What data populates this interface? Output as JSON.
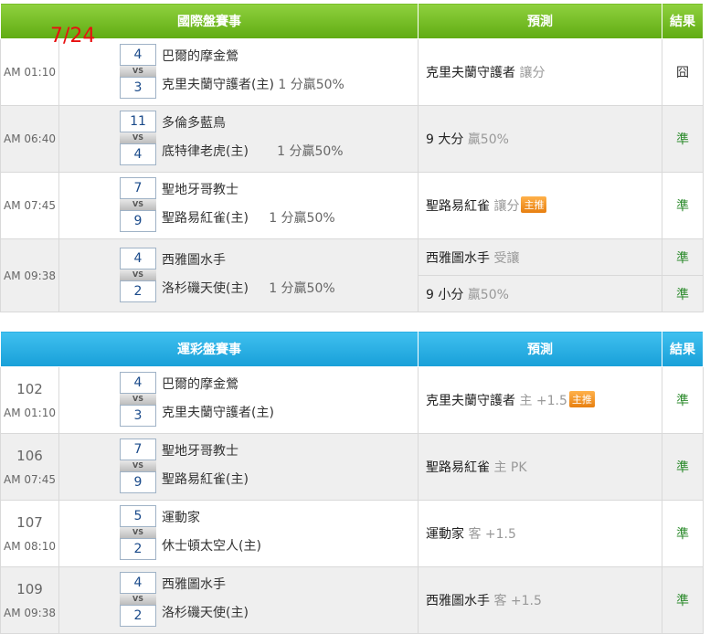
{
  "date_label": "7/24",
  "intl": {
    "header": {
      "title": "國際盤賽事",
      "pred": "預測",
      "res": "結果"
    },
    "rows": [
      {
        "time": "AM 01:10",
        "s1": "4",
        "s2": "3",
        "vs": "VS",
        "team1": "巴爾的摩金鶯",
        "team2": "克里夫蘭守護者(主)",
        "extra": "1 分贏50%",
        "preds": [
          {
            "main": "克里夫蘭守護者",
            "sub": "讓分",
            "res": "囧"
          }
        ]
      },
      {
        "time": "AM 06:40",
        "s1": "11",
        "s2": "4",
        "vs": "VS",
        "team1": "多倫多藍鳥",
        "team2": "底特律老虎(主)",
        "extra": "1 分贏50%",
        "preds": [
          {
            "main": "9 大分",
            "sub": "贏50%",
            "res": "準"
          }
        ]
      },
      {
        "time": "AM 07:45",
        "s1": "7",
        "s2": "9",
        "vs": "VS",
        "team1": "聖地牙哥教士",
        "team2": "聖路易紅雀(主)",
        "extra": "1 分贏50%",
        "preds": [
          {
            "main": "聖路易紅雀",
            "sub": "讓分",
            "badge": "主推",
            "res": "準"
          }
        ]
      },
      {
        "time": "AM 09:38",
        "s1": "4",
        "s2": "2",
        "vs": "VS",
        "team1": "西雅圖水手",
        "team2": "洛杉磯天使(主)",
        "extra": "1 分贏50%",
        "preds": [
          {
            "main": "西雅圖水手",
            "sub": "受讓",
            "res": "準"
          },
          {
            "main": "9 小分",
            "sub": "贏50%",
            "res": "準"
          }
        ]
      }
    ]
  },
  "lottery": {
    "header": {
      "title": "運彩盤賽事",
      "pred": "預測",
      "res": "結果"
    },
    "rows": [
      {
        "num": "102",
        "time": "AM 01:10",
        "s1": "4",
        "s2": "3",
        "vs": "VS",
        "team1": "巴爾的摩金鶯",
        "team2": "克里夫蘭守護者(主)",
        "pred": "克里夫蘭守護者",
        "sub": "主 +1.5",
        "badge": "主推",
        "res": "準"
      },
      {
        "num": "106",
        "time": "AM 07:45",
        "s1": "7",
        "s2": "9",
        "vs": "VS",
        "team1": "聖地牙哥教士",
        "team2": "聖路易紅雀(主)",
        "pred": "聖路易紅雀",
        "sub": "主 PK",
        "res": "準"
      },
      {
        "num": "107",
        "time": "AM 08:10",
        "s1": "5",
        "s2": "2",
        "vs": "VS",
        "team1": "運動家",
        "team2": "休士頓太空人(主)",
        "pred": "運動家",
        "sub": "客 +1.5",
        "res": "準"
      },
      {
        "num": "109",
        "time": "AM 09:38",
        "s1": "4",
        "s2": "2",
        "vs": "VS",
        "team1": "西雅圖水手",
        "team2": "洛杉磯天使(主)",
        "pred": "西雅圖水手",
        "sub": "客 +1.5",
        "res": "準"
      }
    ]
  }
}
